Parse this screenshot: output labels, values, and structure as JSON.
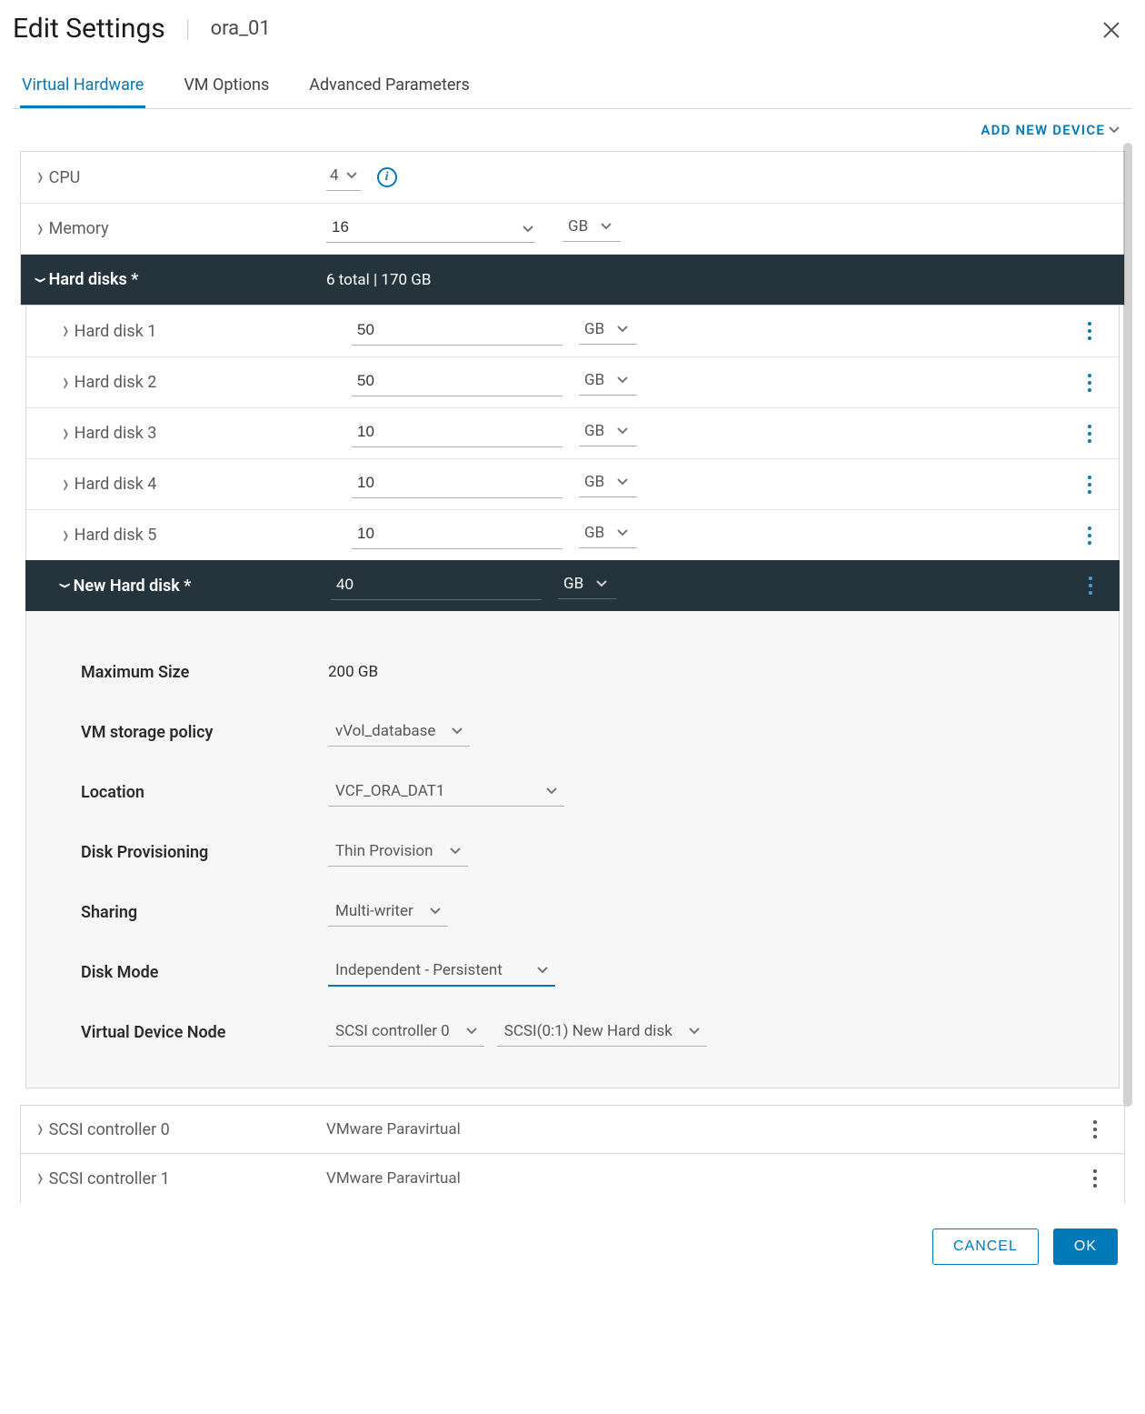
{
  "dialog": {
    "title": "Edit Settings",
    "vm_name": "ora_01"
  },
  "tabs": {
    "virtual_hardware": "Virtual Hardware",
    "vm_options": "VM Options",
    "advanced": "Advanced Parameters"
  },
  "toolbar": {
    "add_device": "ADD NEW DEVICE"
  },
  "cpu": {
    "label": "CPU",
    "value": "4",
    "info": "i"
  },
  "memory": {
    "label": "Memory",
    "value": "16",
    "unit": "GB"
  },
  "hard_disks_header": {
    "label": "Hard disks *",
    "summary": "6 total | 170 GB"
  },
  "disks": [
    {
      "label": "Hard disk 1",
      "size": "50",
      "unit": "GB"
    },
    {
      "label": "Hard disk 2",
      "size": "50",
      "unit": "GB"
    },
    {
      "label": "Hard disk 3",
      "size": "10",
      "unit": "GB"
    },
    {
      "label": "Hard disk 4",
      "size": "10",
      "unit": "GB"
    },
    {
      "label": "Hard disk 5",
      "size": "10",
      "unit": "GB"
    }
  ],
  "new_disk": {
    "label": "New Hard disk *",
    "size": "40",
    "unit": "GB"
  },
  "new_disk_details": {
    "max_size": {
      "label": "Maximum Size",
      "value": "200 GB"
    },
    "storage_policy": {
      "label": "VM storage policy",
      "value": "vVol_database"
    },
    "location": {
      "label": "Location",
      "value": "VCF_ORA_DAT1"
    },
    "provisioning": {
      "label": "Disk Provisioning",
      "value": "Thin Provision"
    },
    "sharing": {
      "label": "Sharing",
      "value": "Multi-writer"
    },
    "disk_mode": {
      "label": "Disk Mode",
      "value": "Independent - Persistent"
    },
    "vdn": {
      "label": "Virtual Device Node",
      "controller": "SCSI controller 0",
      "slot": "SCSI(0:1) New Hard disk"
    }
  },
  "scsi": [
    {
      "label": "SCSI controller 0",
      "type": "VMware Paravirtual"
    },
    {
      "label": "SCSI controller 1",
      "type": "VMware Paravirtual"
    }
  ],
  "footer": {
    "cancel": "CANCEL",
    "ok": "OK"
  }
}
